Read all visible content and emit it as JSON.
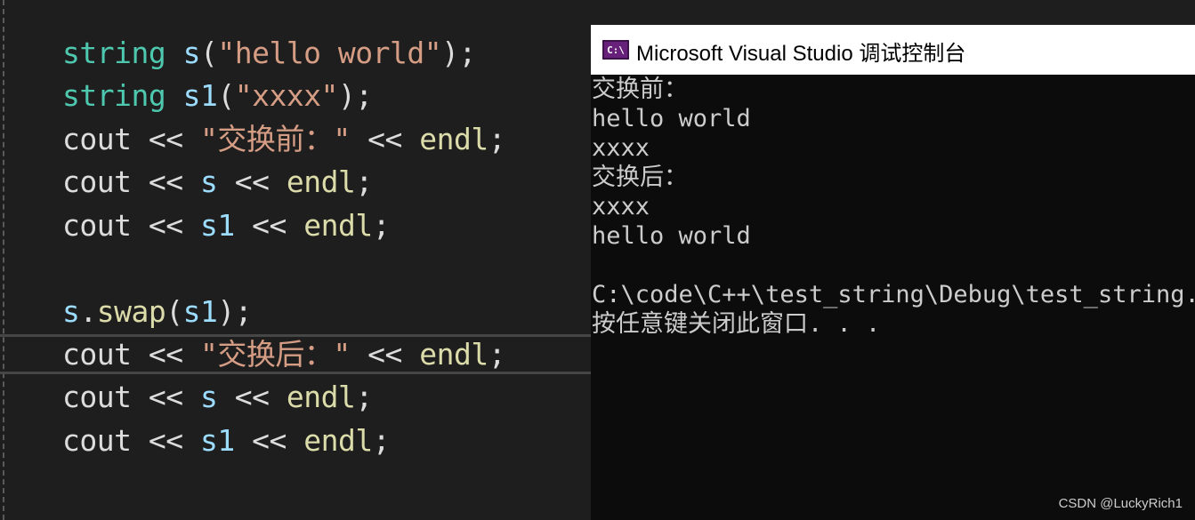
{
  "editor": {
    "lines": [
      {
        "type": "string",
        "name": "s",
        "open": "(",
        "lit": "\"hello world\"",
        "close": ");"
      },
      {
        "type": "string",
        "name": "s1",
        "open": "(",
        "lit": "\"xxxx\"",
        "close": ");"
      },
      {
        "cout": "cout",
        "op": "<<",
        "lit": "\"交换前：\"",
        "op2": "<<",
        "endl": "endl",
        "semi": ";"
      },
      {
        "cout": "cout",
        "op": "<<",
        "var": "s",
        "op2": "<<",
        "endl": "endl",
        "semi": ";"
      },
      {
        "cout": "cout",
        "op": "<<",
        "var": "s1",
        "op2": "<<",
        "endl": "endl",
        "semi": ";"
      },
      {
        "obj": "s",
        "dot": ".",
        "fn": "swap",
        "open": "(",
        "arg": "s1",
        "close": ");"
      },
      {
        "cout": "cout",
        "op": "<<",
        "lit": "\"交换后：\"",
        "op2": "<<",
        "endl": "endl",
        "semi": ";"
      },
      {
        "cout": "cout",
        "op": "<<",
        "var": "s",
        "op2": "<<",
        "endl": "endl",
        "semi": ";"
      },
      {
        "cout": "cout",
        "op": "<<",
        "var": "s1",
        "op2": "<<",
        "endl": "endl",
        "semi": ";"
      }
    ]
  },
  "console": {
    "title": "Microsoft Visual Studio 调试控制台",
    "icon_text": "C:\\",
    "icon": "visual-studio-console-icon",
    "output": [
      "交换前：",
      "hello world",
      "xxxx",
      "交换后：",
      "xxxx",
      "hello world",
      "",
      "C:\\code\\C++\\test_string\\Debug\\test_string.e",
      "按任意键关闭此窗口. . ."
    ]
  },
  "watermark": "CSDN @LuckyRich1",
  "colors": {
    "editor_bg": "#1e1e1e",
    "type": "#4ec9b0",
    "identifier": "#9cdcfe",
    "string": "#d69d85",
    "function": "#dcdcaa",
    "console_bg": "#0c0c0c",
    "console_text": "#cccccc"
  }
}
